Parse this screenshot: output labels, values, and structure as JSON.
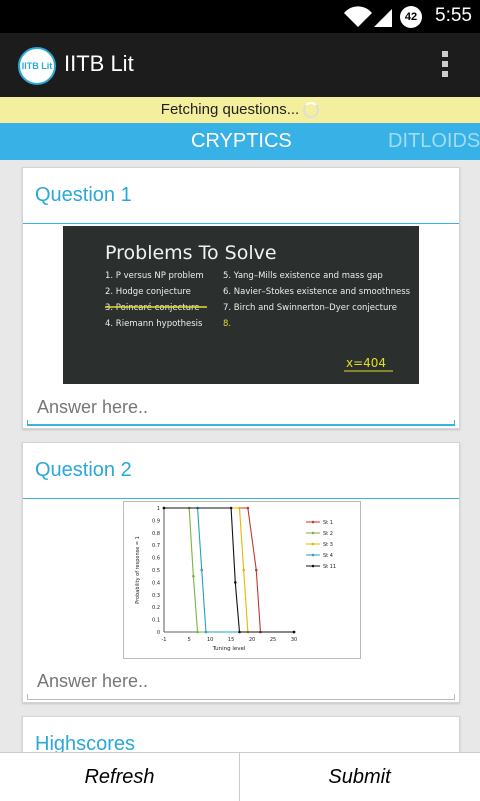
{
  "status_bar": {
    "time": "5:55",
    "battery": "42",
    "icons": [
      "wifi-icon",
      "signal-icon",
      "battery-icon"
    ]
  },
  "app": {
    "title": "IITB Lit",
    "logo_text": "IITB Lit"
  },
  "fetch_banner": {
    "text": "Fetching questions..."
  },
  "tabs": [
    {
      "label": "CRYPTICS",
      "active": true
    },
    {
      "label": "DITLOIDS",
      "active": false
    }
  ],
  "questions": [
    {
      "title": "Question 1",
      "answer_placeholder": "Answer here..",
      "image": {
        "heading": "Problems To Solve",
        "items_left": [
          "1. P versus NP problem",
          "2. Hodge conjecture",
          "3. Poincaré conjecture",
          "4. Riemann hypothesis"
        ],
        "items_right": [
          "5. Yang–Mills existence and mass gap",
          "6. Navier–Stokes existence and smoothness",
          "7. Birch and Swinnerton–Dyer conjecture",
          "8."
        ],
        "note": "x=404"
      }
    },
    {
      "title": "Question 2",
      "answer_placeholder": "Answer here..",
      "image": {
        "chart_data": {
          "type": "line",
          "xlabel": "Tuning level",
          "ylabel": "Probability of response = 1",
          "xlim": [
            -1,
            30
          ],
          "ylim": [
            0,
            1
          ],
          "xticks": [
            "-1",
            "5",
            "10",
            "15",
            "20",
            "25",
            "30"
          ],
          "yticks": [
            "0",
            "0.1",
            "0.2",
            "0.3",
            "0.4",
            "0.5",
            "0.6",
            "0.7",
            "0.8",
            "0.9",
            "1"
          ],
          "series": [
            {
              "name": "St 1",
              "color": "#c0392b",
              "x": [
                -1,
                19,
                21,
                22,
                30
              ],
              "values": [
                1,
                1,
                0.5,
                0,
                0
              ]
            },
            {
              "name": "St 2",
              "color": "#7cb342",
              "x": [
                -1,
                5,
                6,
                7,
                30
              ],
              "values": [
                1,
                1,
                0.45,
                0,
                0
              ]
            },
            {
              "name": "St 3",
              "color": "#e6b800",
              "x": [
                -1,
                17,
                18,
                19,
                30
              ],
              "values": [
                1,
                1,
                0.5,
                0,
                0
              ]
            },
            {
              "name": "St 4",
              "color": "#26a0c0",
              "x": [
                -1,
                7,
                8,
                9,
                30
              ],
              "values": [
                1,
                1,
                0.5,
                0,
                0
              ]
            },
            {
              "name": "St 11",
              "color": "#111111",
              "x": [
                -1,
                15,
                16,
                17,
                30
              ],
              "values": [
                1,
                1,
                0.4,
                0,
                0
              ]
            }
          ]
        }
      }
    }
  ],
  "highscores": {
    "title": "Highscores"
  },
  "bottom": {
    "refresh_label": "Refresh",
    "submit_label": "Submit"
  },
  "colors": {
    "accent": "#37b1e6",
    "banner": "#f3ef9c",
    "actionbar": "#1c1c1c"
  }
}
